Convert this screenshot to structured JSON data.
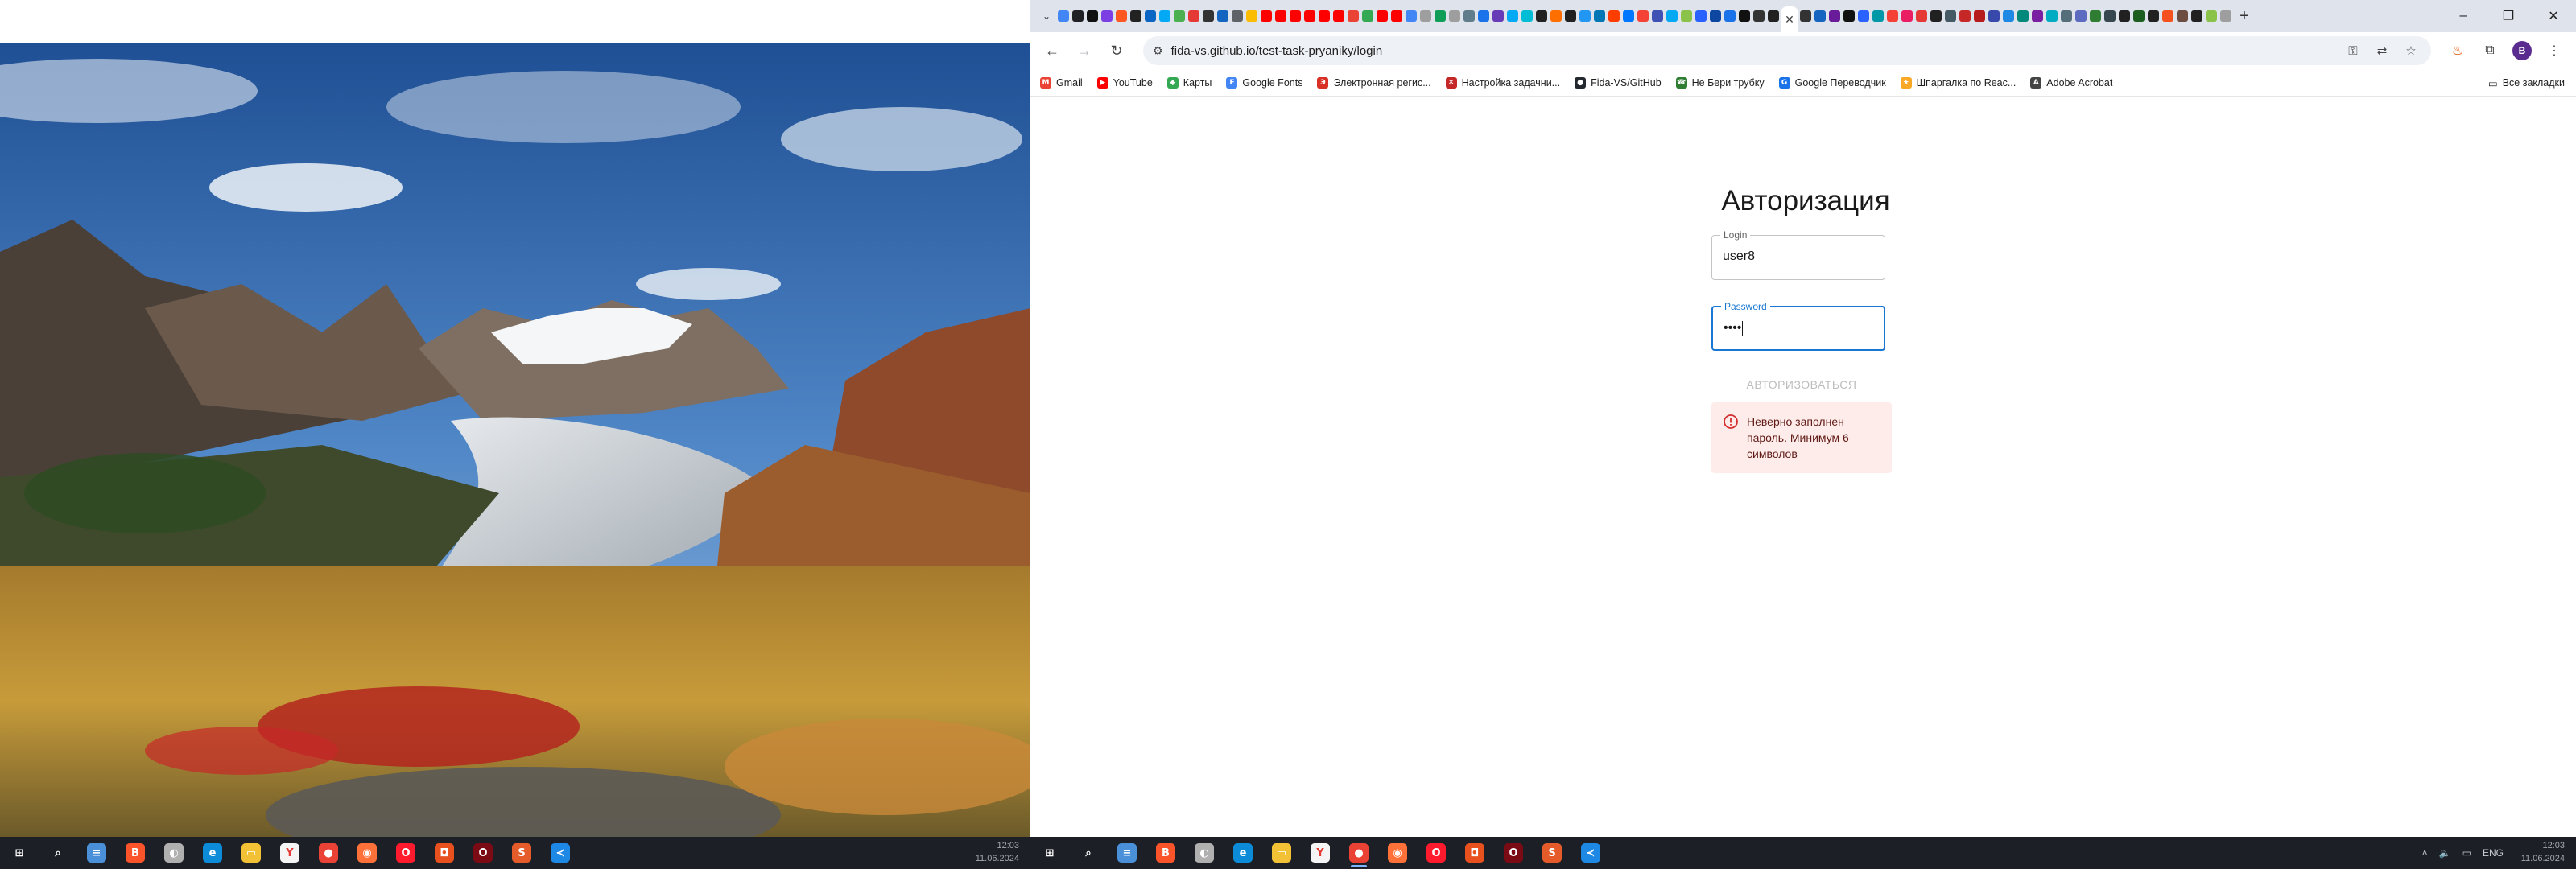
{
  "browser": {
    "url": "fida-vs.github.io/test-task-pryaniky/login",
    "profile_initial": "B",
    "new_tab": "+",
    "close_tab": "✕",
    "pinned_tab_colors": [
      "#4285f4",
      "#202124",
      "#111111",
      "#7b3fe4",
      "#ff5722",
      "#222222",
      "#0a66c2",
      "#03a9f4",
      "#4caf50",
      "#e53935",
      "#333333",
      "#1565c0",
      "#5f6368",
      "#fbbc04",
      "#ff0000",
      "#ff0000",
      "#ff0000",
      "#ff0000",
      "#ff0000",
      "#ff0000",
      "#ea4335",
      "#34a853",
      "#ff0000",
      "#ff0000",
      "#4285f4",
      "#9e9e9e",
      "#0f9d58",
      "#9e9e9e",
      "#607d8b",
      "#1a73e8",
      "#673ab7",
      "#03a9f4",
      "#00bcd4",
      "#222222",
      "#ff6f00",
      "#212121",
      "#2196f3",
      "#0077b5",
      "#ff3d00",
      "#0077ff",
      "#f44336",
      "#3f51b5",
      "#03a9f4",
      "#8bc34a",
      "#2962ff",
      "#0d47a1",
      "#1a73e8",
      "#111111",
      "#333333",
      "#212121"
    ],
    "pinned_tab_colors_after": [
      "#333333",
      "#1565c0",
      "#6a1b9a",
      "#111111",
      "#2962ff",
      "#0097a7",
      "#f44336",
      "#e91e63",
      "#e53935",
      "#212121",
      "#455a64",
      "#c62828",
      "#b71c1c",
      "#3949ab",
      "#1e88e5",
      "#00897b",
      "#7b1fa2",
      "#00acc1",
      "#546e7a",
      "#5c6bc0",
      "#2e7d32",
      "#37474f",
      "#212121",
      "#1b5e20",
      "#212121",
      "#f4511e",
      "#6d4c41",
      "#212121",
      "#8bc34a",
      "#9e9e9e"
    ]
  },
  "bookmarks": [
    {
      "label": "Gmail",
      "icon": "gmail-icon",
      "color": "#ea4335",
      "glyph": "M"
    },
    {
      "label": "YouTube",
      "icon": "youtube-icon",
      "color": "#ff0000",
      "glyph": "▶"
    },
    {
      "label": "Карты",
      "icon": "maps-icon",
      "color": "#34a853",
      "glyph": "◆"
    },
    {
      "label": "Google Fonts",
      "icon": "google-fonts-icon",
      "color": "#4285f4",
      "glyph": "F"
    },
    {
      "label": "Электронная регис...",
      "icon": "registration-icon",
      "color": "#d93025",
      "glyph": "Э"
    },
    {
      "label": "Настройка задачни...",
      "icon": "scheduler-icon",
      "color": "#c62828",
      "glyph": "✕"
    },
    {
      "label": "Fida-VS/GitHub",
      "icon": "github-icon",
      "color": "#24292f",
      "glyph": "●"
    },
    {
      "label": "Не Бери трубку",
      "icon": "phone-icon",
      "color": "#2e7d32",
      "glyph": "☎"
    },
    {
      "label": "Google Переводчик",
      "icon": "translate-icon",
      "color": "#1a73e8",
      "glyph": "G"
    },
    {
      "label": "Шпаргалка по Reac...",
      "icon": "react-cheatsheet-icon",
      "color": "#f9a825",
      "glyph": "★"
    },
    {
      "label": "Adobe Acrobat",
      "icon": "acrobat-icon",
      "color": "#444444",
      "glyph": "A"
    }
  ],
  "all_bookmarks_label": "Все закладки",
  "page": {
    "title": "Авторизация",
    "login_label": "Login",
    "login_value": "user8",
    "password_label": "Password",
    "password_value": "••••",
    "submit_label": "АВТОРИЗОВАТЬСЯ",
    "error_text": "Неверно заполнен пароль. Минимум 6 символов",
    "error_color": "#d32f2f"
  },
  "taskbar": {
    "left_clock_time": "12:03",
    "left_clock_date": "11.06.2024",
    "right_clock_time": "12:03",
    "right_clock_date": "11.06.2024",
    "language": "ENG",
    "apps": [
      {
        "name": "start",
        "color": "#1c1f26",
        "glyph": "⊞"
      },
      {
        "name": "search",
        "color": "#1c1f26",
        "glyph": "⌕"
      },
      {
        "name": "notepad",
        "color": "#4a90d9",
        "glyph": "≡"
      },
      {
        "name": "brave",
        "color": "#fb542b",
        "glyph": "B"
      },
      {
        "name": "app-circle",
        "color": "#b0b0b0",
        "glyph": "◐"
      },
      {
        "name": "edge",
        "color": "#0c8bd8",
        "glyph": "e"
      },
      {
        "name": "explorer",
        "color": "#f3c136",
        "glyph": "▭"
      },
      {
        "name": "yandex",
        "color": "#f5f5f5",
        "glyph": "Y"
      },
      {
        "name": "chrome",
        "color": "#ea4335",
        "glyph": "●"
      },
      {
        "name": "firefox",
        "color": "#ff7139",
        "glyph": "◉"
      },
      {
        "name": "opera",
        "color": "#ff1b2d",
        "glyph": "O"
      },
      {
        "name": "app-orange",
        "color": "#e8501e",
        "glyph": "◘"
      },
      {
        "name": "opera-gx",
        "color": "#7a0a14",
        "glyph": "O"
      },
      {
        "name": "sublime",
        "color": "#e55b2a",
        "glyph": "S"
      },
      {
        "name": "vscode",
        "color": "#1e88e5",
        "glyph": "≺"
      }
    ]
  }
}
